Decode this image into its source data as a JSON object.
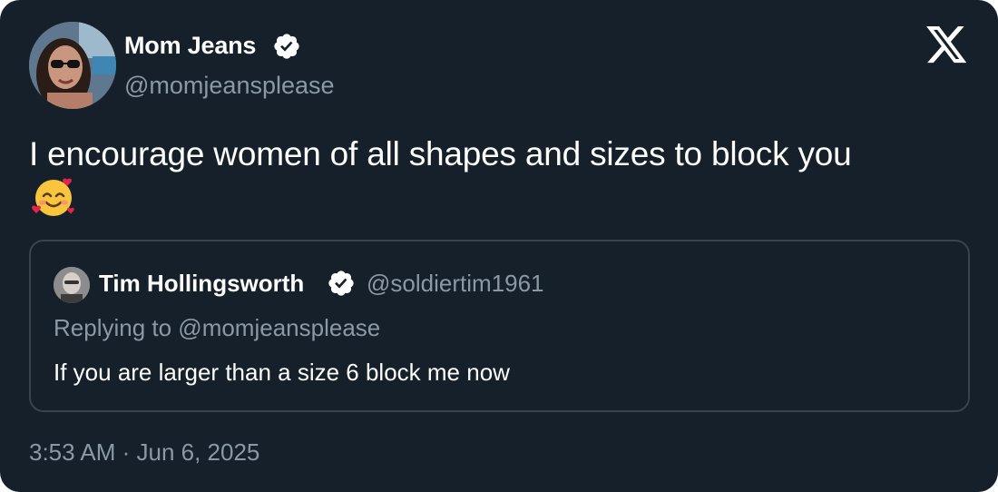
{
  "author": {
    "name": "Mom Jeans",
    "handle": "@momjeansplease",
    "verified": true
  },
  "brand": {
    "logo_icon": "x-logo-icon"
  },
  "tweet": {
    "text": "I encourage women of all shapes and sizes to block you",
    "emoji": "smiling-face-with-hearts-icon"
  },
  "quoted_tweet": {
    "author_name": "Tim Hollingsworth",
    "author_handle": "@soldiertim1961",
    "verified": true,
    "replying_to": "Replying to @momjeansplease",
    "text": "If you are larger than a size 6 block me now"
  },
  "timestamp": "3:53 AM · Jun 6, 2025",
  "colors": {
    "background": "#15202b",
    "primary_text": "#ffffff",
    "secondary_text": "#8b98a5",
    "border": "#38444d",
    "verified_badge": "#ffffff"
  }
}
